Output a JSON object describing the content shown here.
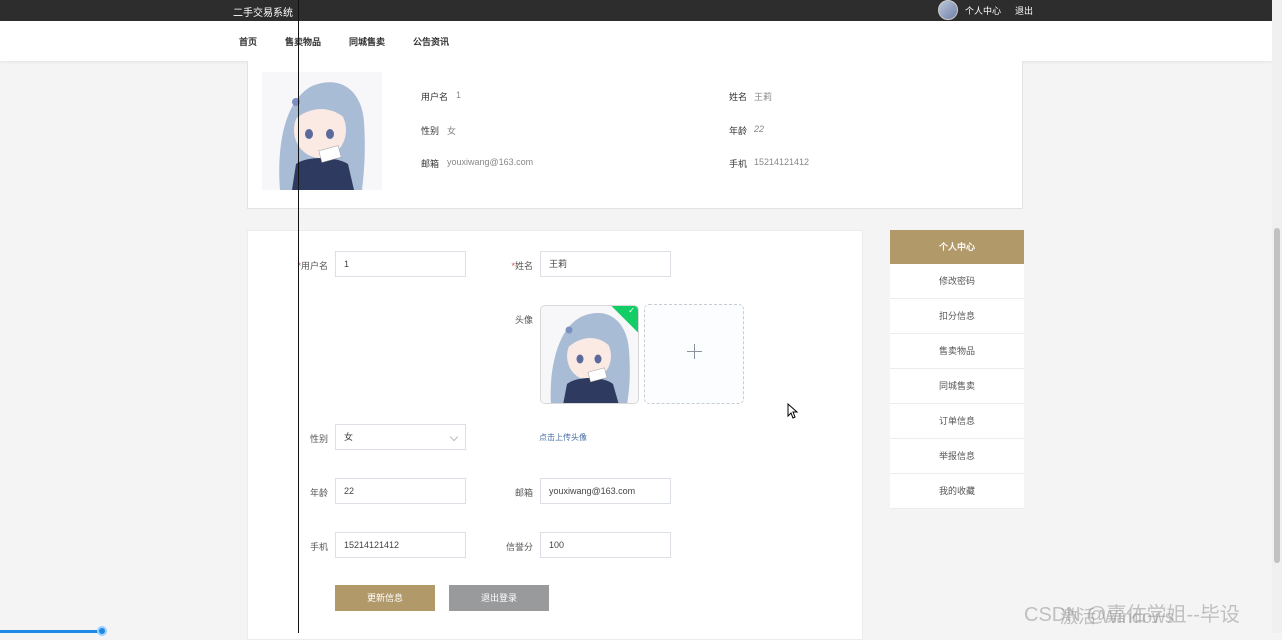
{
  "header": {
    "site_title": "二手交易系统",
    "user_center": "个人中心",
    "logout": "退出"
  },
  "nav": {
    "items": [
      {
        "label": "首页"
      },
      {
        "label": "售卖物品"
      },
      {
        "label": "同城售卖"
      },
      {
        "label": "公告资讯"
      }
    ]
  },
  "profile": {
    "username_label": "用户名",
    "username_value": "1",
    "name_label": "姓名",
    "name_value": "王莉",
    "gender_label": "性别",
    "gender_value": "女",
    "age_label": "年龄",
    "age_value": "22",
    "email_label": "邮箱",
    "email_value": "youxiwang@163.com",
    "phone_label": "手机",
    "phone_value": "15214121412"
  },
  "form": {
    "username_label": "用户名",
    "username_value": "1",
    "name_label": "姓名",
    "name_value": "王莉",
    "avatar_label": "头像",
    "upload_hint": "点击上传头像",
    "gender_label": "性别",
    "gender_value": "女",
    "age_label": "年龄",
    "age_value": "22",
    "email_label": "邮箱",
    "email_value": "youxiwang@163.com",
    "phone_label": "手机",
    "phone_value": "15214121412",
    "credit_label": "信誉分",
    "credit_value": "100",
    "update_button": "更新信息",
    "logout_button": "退出登录"
  },
  "side_menu": {
    "items": [
      {
        "label": "个人中心",
        "active": true
      },
      {
        "label": "修改密码"
      },
      {
        "label": "扣分信息"
      },
      {
        "label": "售卖物品"
      },
      {
        "label": "同城售卖"
      },
      {
        "label": "订单信息"
      },
      {
        "label": "举报信息"
      },
      {
        "label": "我的收藏"
      }
    ]
  },
  "watermarks": {
    "windows": "激活 Windows",
    "csdn": "CSDN @嘉佑学姐--毕设"
  },
  "colors": {
    "accent": "#b2996a",
    "topbar": "#2d2d2d",
    "required": "#e04c4c",
    "upload_success": "#13ce66"
  }
}
